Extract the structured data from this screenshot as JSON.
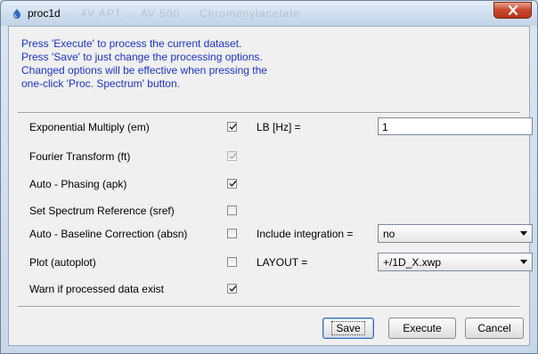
{
  "window": {
    "title": "proc1d",
    "ghost_title": "... 4V APT ... AV 500 ... Chromenylacetate"
  },
  "info_lines": [
    "Press 'Execute' to process the current dataset.",
    "Press 'Save' to just change the processing options.",
    "Changed options will be effective when pressing the",
    "one-click 'Proc. Spectrum' button."
  ],
  "options": [
    {
      "label": "Exponential Multiply (em)",
      "checked": true,
      "disabled": false
    },
    {
      "label": "Fourier Transform (ft)",
      "checked": true,
      "disabled": true
    },
    {
      "label": "Auto - Phasing (apk)",
      "checked": true,
      "disabled": false
    },
    {
      "label": "Set Spectrum Reference (sref)",
      "checked": false,
      "disabled": false
    },
    {
      "label": "Auto - Baseline Correction (absn)",
      "checked": false,
      "disabled": false
    },
    {
      "label": "Plot (autoplot)",
      "checked": false,
      "disabled": false
    },
    {
      "label": "Warn if processed data exist",
      "checked": true,
      "disabled": false
    }
  ],
  "params": {
    "lb_label": "LB [Hz] =",
    "lb_value": "1",
    "integration_label": "Include integration =",
    "integration_value": "no",
    "layout_label": "LAYOUT =",
    "layout_value": "+/1D_X.xwp"
  },
  "buttons": {
    "save": "Save",
    "execute": "Execute",
    "cancel": "Cancel"
  }
}
